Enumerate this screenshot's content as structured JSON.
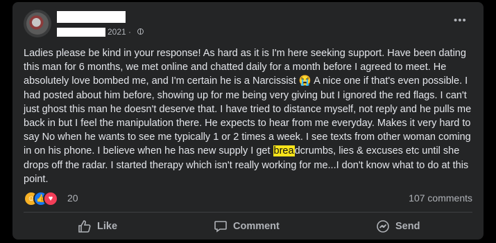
{
  "post": {
    "timestamp": "2021 ·",
    "text_before_highlight": "Ladies please be kind in your response! As hard as it is I'm here  seeking support. Have been dating this man for 6 months, we met online and chatted daily for a month before I agreed to meet. He absolutely love bombed me, and I'm certain he is a Narcissist 😭 A nice one if that's even possible. I had posted about him before, showing up for me being very giving but I ignored the red flags. I can't just ghost this man he doesn't deserve that. I have tried to distance myself, not reply and he pulls me back in but I feel the manipulation there. He expects to hear from me everyday. Makes it very hard to say No when he wants to see me typically 1 or 2 times a week. I see texts from other woman coming in on his phone. I believe when he has new supply I get ",
    "highlight": "brea",
    "text_after_highlight": "dcrumbs, lies & excuses etc until she drops off the radar. I started therapy which isn't really working for me...I don't know what to do at this point.",
    "reactions": {
      "count": "20",
      "comments": "107 comments"
    }
  },
  "actions": {
    "like": "Like",
    "comment": "Comment",
    "share": "Send"
  },
  "icons": {
    "more": "more-options-icon",
    "privacy": "globe-icon",
    "reactions": [
      "care-icon",
      "like-icon",
      "love-icon"
    ]
  },
  "colors": {
    "card": "#242526",
    "text": "#e4e6eb",
    "muted": "#b0b3b8",
    "highlight": "#f7e31a"
  }
}
